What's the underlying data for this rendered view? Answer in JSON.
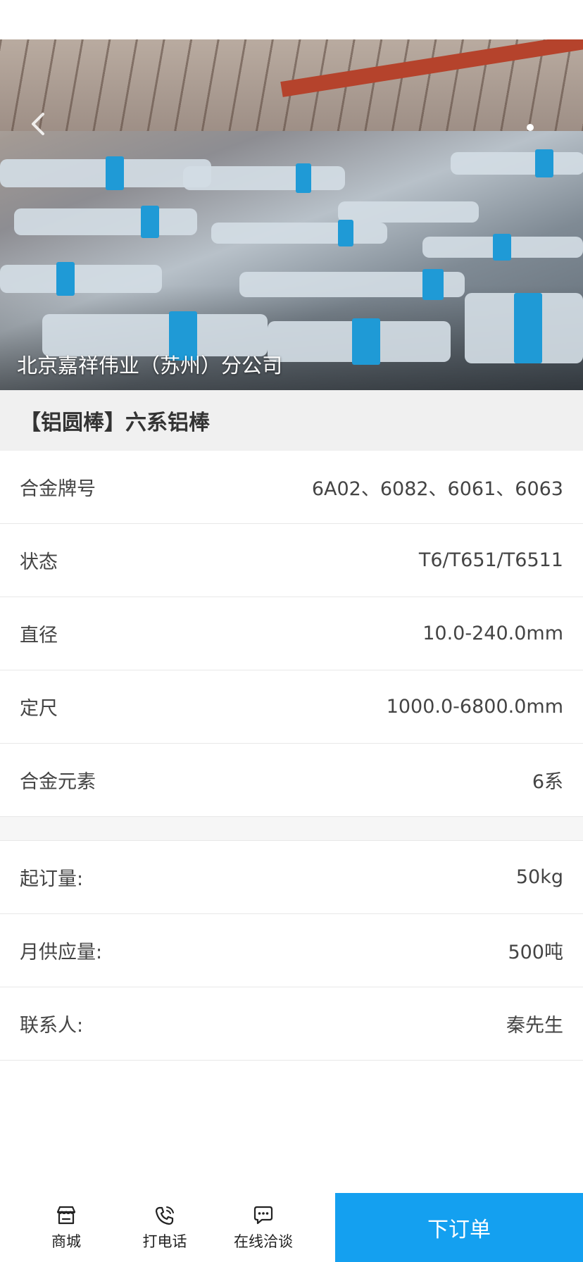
{
  "hero": {
    "company_name": "北京嘉祥伟业（苏州）分公司",
    "carousel_dots": 2,
    "carousel_active": 1,
    "colors": {
      "band": "#1f9ad6",
      "beam": "#b5432c"
    }
  },
  "product": {
    "title": "【铝圆棒】六系铝棒"
  },
  "specs": [
    {
      "label": "合金牌号",
      "value": "6A02、6082、6061、6063"
    },
    {
      "label": "状态",
      "value": "T6/T651/T6511"
    },
    {
      "label": "直径",
      "value": "10.0-240.0mm"
    },
    {
      "label": "定尺",
      "value": "1000.0-6800.0mm"
    },
    {
      "label": "合金元素",
      "value": "6系"
    }
  ],
  "order_info": [
    {
      "label": "起订量:",
      "value": "50kg"
    },
    {
      "label": "月供应量:",
      "value": "500吨"
    },
    {
      "label": "联系人:",
      "value": "秦先生"
    }
  ],
  "bottom_nav": {
    "items": [
      {
        "label": "商城",
        "icon": "shop-icon"
      },
      {
        "label": "打电话",
        "icon": "phone-icon"
      },
      {
        "label": "在线洽谈",
        "icon": "chat-icon"
      }
    ],
    "order_button": "下订单",
    "accent_color": "#14a0f0"
  }
}
